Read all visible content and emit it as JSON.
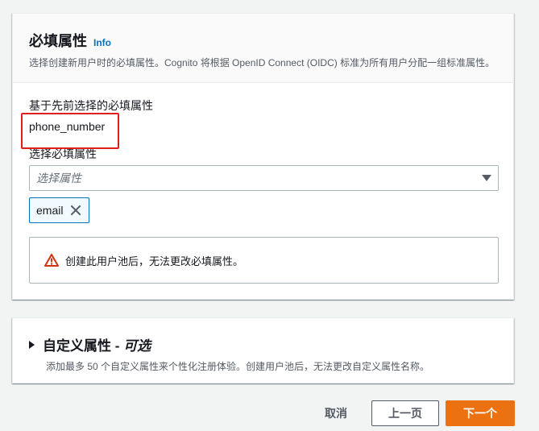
{
  "required_section": {
    "title": "必填属性",
    "info_link": "Info",
    "description": "选择创建新用户时的必填属性。Cognito 将根据 OpenID Connect (OIDC) 标准为所有用户分配一组标准属性。",
    "preselected_label": "基于先前选择的必填属性",
    "preselected_value": "phone_number",
    "select_label": "选择必填属性",
    "select_placeholder": "选择属性",
    "tokens": [
      {
        "label": "email"
      }
    ],
    "alert_text": "创建此用户池后，无法更改必填属性。",
    "alert_icon": "warning-icon",
    "alert_icon_color": "#d13212",
    "highlight_color": "#e02020"
  },
  "custom_section": {
    "title": "自定义属性",
    "title_separator": " - ",
    "title_optional": "可选",
    "description": "添加最多 50 个自定义属性来个性化注册体验。创建用户池后，无法更改自定义属性名称。"
  },
  "footer": {
    "cancel_label": "取消",
    "previous_label": "上一页",
    "next_label": "下一个",
    "primary_color": "#ec7211"
  }
}
